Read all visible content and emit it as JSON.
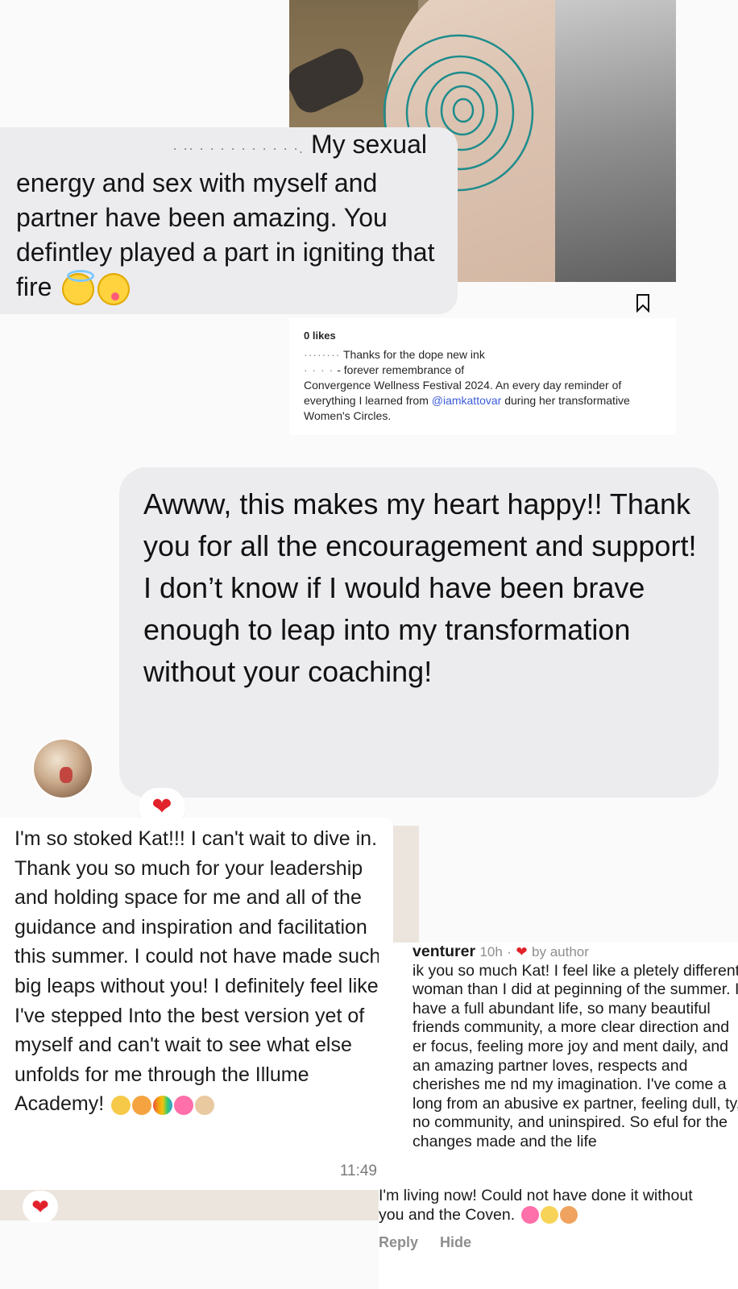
{
  "instagram_post": {
    "likes": "0 likes",
    "caption_user": "········",
    "caption_line1": "Thanks for the dope new ink",
    "caption_line2_prefix": "· · · ·",
    "caption_line2": "- forever remembrance of",
    "caption_rest_before": "Convergence Wellness Festival 2024. An every day reminder of everything I learned from ",
    "mention": "@iamkattovar",
    "caption_rest_after": " during her transformative Women's Circles."
  },
  "message_1": {
    "redacted_prefix": "· ·· · · · · · · · · · ·.",
    "head": "My sexual",
    "body": "energy and sex with myself and partner have been amazing. You defintley played a part in igniting that fire"
  },
  "reply": {
    "text": "Awww, this makes my heart happy!! Thank you for all the encouragement and support! I don’t know if I would have been brave enough to leap into my transformation without your coaching!",
    "reaction": "❤"
  },
  "whatsapp": {
    "text": "I'm so stoked Kat!!! I can't wait to dive in. Thank you so much for your leadership and holding space for me and all of the guidance and inspiration and facilitation this summer. I could not have made such big leaps without you! I definitely feel like I've stepped Into the best version yet of myself and can't wait to see what else unfolds for me through the Illume Academy!",
    "time": "11:49",
    "reaction": "❤",
    "emoji_colors": [
      "#f7c948",
      "#f4a340",
      "#6ec1e4",
      "#ff6fa9",
      "#e8c9a0"
    ]
  },
  "comment": {
    "user": "venturer",
    "time": "10h",
    "separator": "·",
    "heart": "❤",
    "by_author": "by author",
    "text": "ik you so much Kat! I feel like a pletely different woman than I did at peginning of the summer. I have a full abundant life, so many beautiful friends community, a more clear direction and er focus, feeling more joy and ment daily, and an amazing partner loves, respects and cherishes me nd my imagination. I've come a long from an abusive ex partner, feeling dull, ty, no community, and uninspired. So eful for the changes made and the life",
    "tail": "I'm living now! Could not have done it without you and the Coven.",
    "reply_label": "Reply",
    "hide_label": "Hide"
  },
  "colors": {
    "bubble_gray": "#ececef",
    "whatsapp_bg": "#ece5dd",
    "heart_red": "#e1222b",
    "mention_blue": "#3b5bdb"
  }
}
